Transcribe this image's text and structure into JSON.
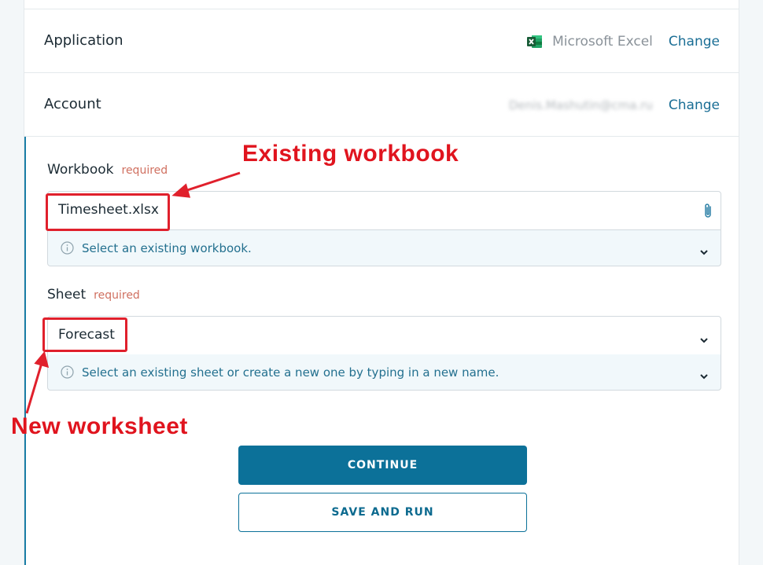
{
  "application": {
    "label": "Application",
    "value": "Microsoft Excel",
    "icon": "excel-icon",
    "change_label": "Change"
  },
  "account": {
    "label": "Account",
    "value": "Denis.Mashutin@cma.ru",
    "change_label": "Change"
  },
  "workbook": {
    "label": "Workbook",
    "required": "required",
    "value": "Timesheet.xlsx",
    "hint": "Select an existing workbook."
  },
  "sheet": {
    "label": "Sheet",
    "required": "required",
    "value": "Forecast",
    "hint": "Select an existing sheet or create a new one by typing in a new name."
  },
  "buttons": {
    "continue": "CONTINUE",
    "save_and_run": "SAVE AND RUN"
  },
  "annotations": {
    "workbook": "Existing workbook",
    "sheet": "New worksheet"
  },
  "colors": {
    "accent": "#0c7199",
    "annotation": "#e0202c",
    "hint_bg": "#f1f8fb"
  }
}
